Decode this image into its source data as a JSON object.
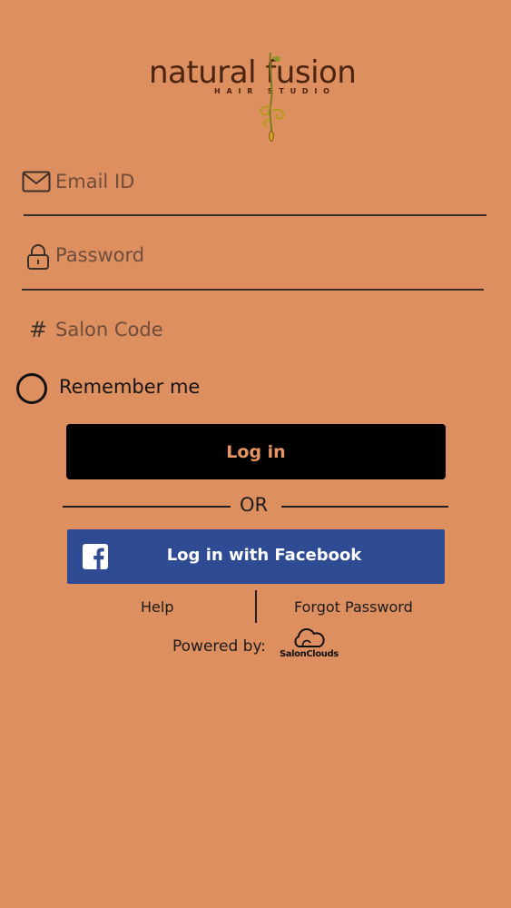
{
  "brand": {
    "name": "natural fusion",
    "tagline": "HAIR STUDIO"
  },
  "form": {
    "email_placeholder": "Email ID",
    "password_placeholder": "Password",
    "salon_code_placeholder": "Salon Code",
    "remember_label": "Remember me",
    "remember_checked": false
  },
  "actions": {
    "login_label": "Log in",
    "or_label": "OR",
    "facebook_label": "Log in with Facebook",
    "help_label": "Help",
    "forgot_label": "Forgot Password"
  },
  "footer": {
    "powered_by_label": "Powered by:",
    "provider_logo_text": "SalonClouds"
  },
  "icons": {
    "email": "mail-icon",
    "password": "lock-icon",
    "salon_code": "hash-icon",
    "facebook": "facebook-icon",
    "provider": "cloud-icon"
  },
  "colors": {
    "background": "#DE8F5F",
    "login_button": "#000000",
    "login_text": "#E79560",
    "facebook_button": "#2F4B94",
    "brand_text": "#4B2410"
  }
}
